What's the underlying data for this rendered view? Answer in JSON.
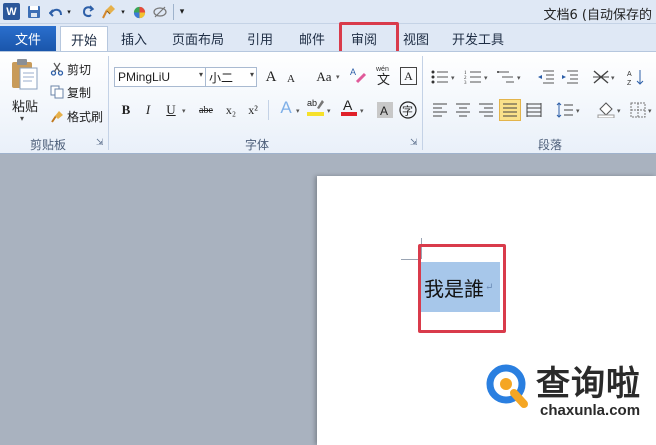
{
  "qat": {
    "logo": "W",
    "save_icon": "save-icon",
    "undo_icon": "undo-icon",
    "redo_icon": "redo-icon"
  },
  "title": "文档6 (自动保存的",
  "tabs": {
    "file": "文件",
    "items": [
      "开始",
      "插入",
      "页面布局",
      "引用",
      "邮件",
      "审阅",
      "视图",
      "开发工具"
    ],
    "active": "开始",
    "highlighted": "审阅"
  },
  "clipboard": {
    "paste": "粘贴",
    "cut": "剪切",
    "copy": "复制",
    "format_painter": "格式刷",
    "group_label": "剪贴板"
  },
  "font": {
    "name": "PMingLiU",
    "size": "小二",
    "group_label": "字体",
    "buttons": {
      "bold": "B",
      "italic": "I",
      "underline": "U",
      "strike": "abe",
      "subscript": "x₂",
      "superscript": "x²",
      "grow": "A",
      "shrink": "A",
      "case": "Aa",
      "phonetic": "wén",
      "phonetic_char": "文",
      "border_char": "A",
      "effects": "A",
      "highlight": "ab",
      "color": "A",
      "enclose": "字"
    },
    "colors": {
      "highlight": "#f6e12b",
      "font_color": "#e0202a"
    }
  },
  "paragraph": {
    "group_label": "段落"
  },
  "document": {
    "selected_text": "我是誰",
    "para_mark": "↵"
  },
  "watermark": {
    "brand": "查询啦",
    "url": "chaxunla.com",
    "accent": "#2a7fe0",
    "accent2": "#f5a623"
  },
  "highlight_color": "#d93b4b"
}
